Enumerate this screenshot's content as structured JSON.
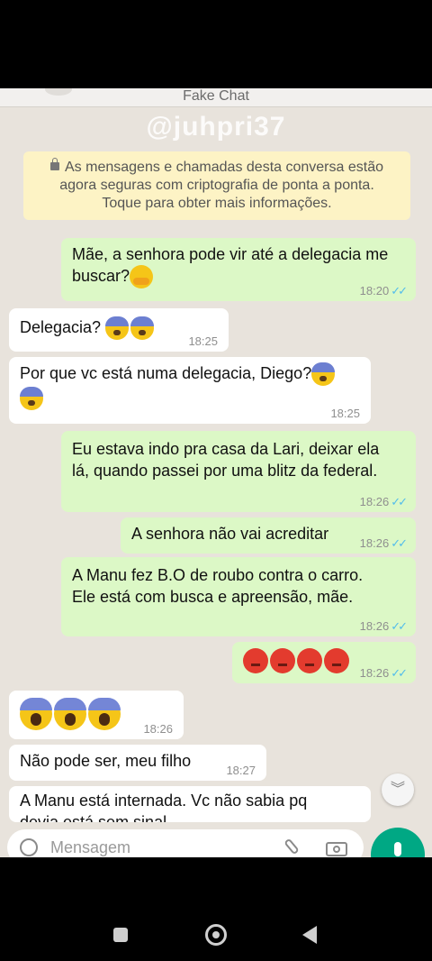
{
  "header": {
    "title": "Fake Chat"
  },
  "watermark": "@juhpri37",
  "encryption_notice": {
    "line1": "As mensagens e chamadas desta conversa estão",
    "line2": "agora seguras com criptografia de ponta a ponta.",
    "line3": "Toque para obter mais informações."
  },
  "messages": [
    {
      "direction": "out",
      "line1": "Mãe, a senhora pode vir até a delegacia me",
      "line2": "buscar?",
      "emoji": "smiling-hands-emoji",
      "time": "18:20"
    },
    {
      "direction": "in",
      "text": "Delegacia?",
      "emoji": "fearful-face-emoji",
      "emoji_count": 2,
      "time": "18:25"
    },
    {
      "direction": "in",
      "text": "Por que vc está numa delegacia, Diego?",
      "emoji": "fearful-face-emoji",
      "emoji_count": 2,
      "time": "18:25"
    },
    {
      "direction": "out",
      "line1": "Eu estava indo pra casa da Lari, deixar ela",
      "line2": "lá, quando passei por uma blitz da federal.",
      "time": "18:26"
    },
    {
      "direction": "out",
      "text": "A senhora não vai acreditar",
      "time": "18:26"
    },
    {
      "direction": "out",
      "line1": "A Manu fez B.O de roubo contra o carro.",
      "line2": "Ele está com busca e apreensão, mãe.",
      "time": "18:26"
    },
    {
      "direction": "out",
      "emoji": "angry-face-emoji",
      "emoji_count": 4,
      "time": "18:26"
    },
    {
      "direction": "in",
      "emoji": "screaming-face-emoji",
      "emoji_count": 3,
      "time": "18:26"
    },
    {
      "direction": "in",
      "text": "Não pode ser, meu filho",
      "time": "18:27"
    },
    {
      "direction": "in",
      "line1": "A Manu está internada. Vc não sabia pq",
      "line2": "devia está sem sinal"
    }
  ],
  "input": {
    "placeholder": "Mensagem"
  },
  "colors": {
    "outgoing": "#dcf8c6",
    "incoming": "#ffffff",
    "accent": "#00a884",
    "ticks": "#53bdeb",
    "notice": "#fdf3c5"
  }
}
